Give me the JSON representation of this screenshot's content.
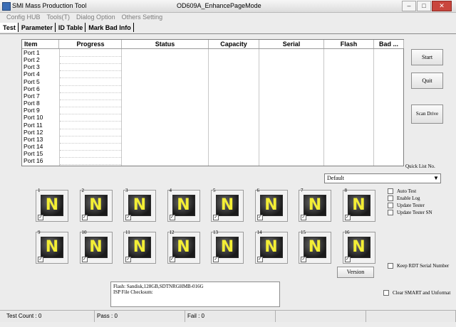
{
  "window": {
    "app_title": "SMI Mass Production Tool",
    "doc_title": "OD609A_EnhancePageMode",
    "buttons": [
      "–",
      "□",
      "✕"
    ]
  },
  "menu": [
    "Config HUB",
    "Tools(T)",
    "Dialog Option",
    "Others Setting"
  ],
  "tabs": [
    "Test",
    "Parameter",
    "ID Table",
    "Mark Bad Info"
  ],
  "table": {
    "columns": [
      "Item",
      "Progress",
      "Status",
      "Capacity",
      "Serial",
      "Flash",
      "Bad ..."
    ],
    "rows": [
      "Port 1",
      "Port 2",
      "Port 3",
      "Port 4",
      "Port 5",
      "Port 6",
      "Port 7",
      "Port 8",
      "Port 9",
      "Port 10",
      "Port 11",
      "Port 12",
      "Port 13",
      "Port 14",
      "Port 15",
      "Port 16"
    ]
  },
  "right_buttons": {
    "start": "Start",
    "quit": "Quit",
    "scan": "Scan Drive"
  },
  "quick_list": {
    "label": "Quick List No.",
    "value": "Default"
  },
  "ports": {
    "icon_letter": "N",
    "row1": [
      "1",
      "2",
      "3",
      "4",
      "5",
      "6",
      "7",
      "8"
    ],
    "row2": [
      "9",
      "10",
      "11",
      "12",
      "13",
      "14",
      "15",
      "16"
    ],
    "check_mark": "✓"
  },
  "options": [
    "Auto Test",
    "Enable Log",
    "Update Tester",
    "Update Tester SN"
  ],
  "keep_rdt": "Keep RDT Serial Number",
  "clear_smart": "Clear SMART and Unformat",
  "version_button": "Version",
  "memo_lines": [
    "Flash: Sandisk,128GB,SDTNRGHMB-016G",
    "ISP File Checksum:"
  ],
  "status": {
    "test_count": "Test Count : 0",
    "pass": "Pass : 0",
    "fail": "Fail : 0"
  },
  "colors": {
    "icon_letter": "#f3ee35",
    "close_button": "#c9463d"
  }
}
